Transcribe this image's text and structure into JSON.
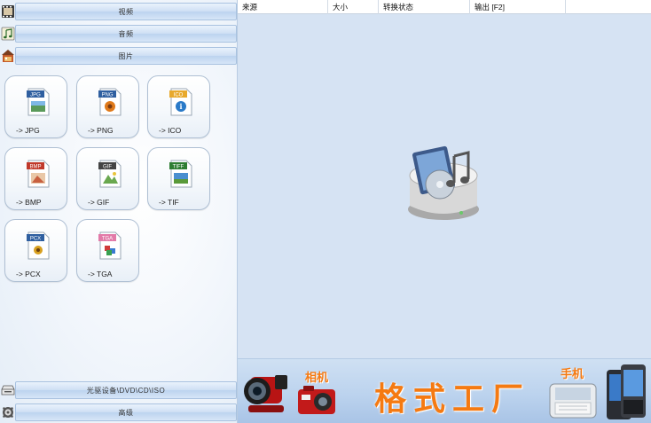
{
  "categories": {
    "video": "视频",
    "audio": "音频",
    "picture": "图片",
    "rom": "光驱设备\\DVD\\CD\\ISO",
    "advanced": "高级"
  },
  "formats": [
    {
      "badge": "JPG",
      "label": "-> JPG",
      "badge_color": "#2f5fa0"
    },
    {
      "badge": "PNG",
      "label": "-> PNG",
      "badge_color": "#2f5fa0"
    },
    {
      "badge": "ICO",
      "label": "-> ICO",
      "badge_color": "#e8a92c"
    },
    {
      "badge": "BMP",
      "label": "-> BMP",
      "badge_color": "#c0392b"
    },
    {
      "badge": "GIF",
      "label": "-> GIF",
      "badge_color": "#444444"
    },
    {
      "badge": "TIFF",
      "label": "-> TIF",
      "badge_color": "#2e7d32"
    },
    {
      "badge": "PCX",
      "label": "-> PCX",
      "badge_color": "#2f5fa0"
    },
    {
      "badge": "TGA",
      "label": "-> TGA",
      "badge_color": "#e27aa8"
    }
  ],
  "table_headers": {
    "source": "来源",
    "size": "大小",
    "status": "转换状态",
    "output": "输出 [F2]"
  },
  "banner": {
    "brand": "格式工厂",
    "camera_tag": "相机",
    "phone_tag": "手机"
  },
  "colors": {
    "accent_orange": "#f57a12",
    "panel_blue": "#d6e3f3"
  },
  "icons": {
    "video": "film-icon",
    "audio": "music-note-icon",
    "picture": "image-icon",
    "rom": "disc-drive-icon",
    "advanced": "gear-icon"
  }
}
